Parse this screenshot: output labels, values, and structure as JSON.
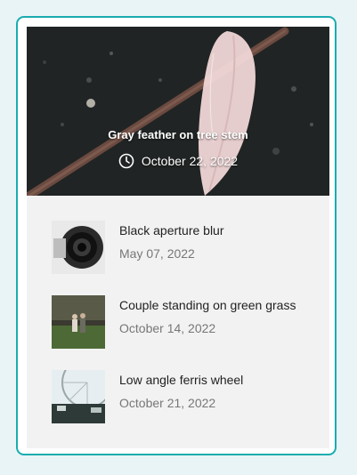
{
  "featured": {
    "title": "Gray feather on tree stem",
    "date": "October 22, 2022",
    "date_icon": "clock-icon"
  },
  "posts": [
    {
      "title": "Black aperture blur",
      "date": "May 07, 2022",
      "thumb": "camera-lens-image"
    },
    {
      "title": "Couple standing on green grass",
      "date": "October 14, 2022",
      "thumb": "couple-grass-image"
    },
    {
      "title": "Low angle ferris wheel",
      "date": "October 21, 2022",
      "thumb": "ferris-wheel-image"
    }
  ],
  "colors": {
    "border": "#1aacb0",
    "page_background": "#e8f4f5",
    "panel_background": "#f2f2f2"
  }
}
